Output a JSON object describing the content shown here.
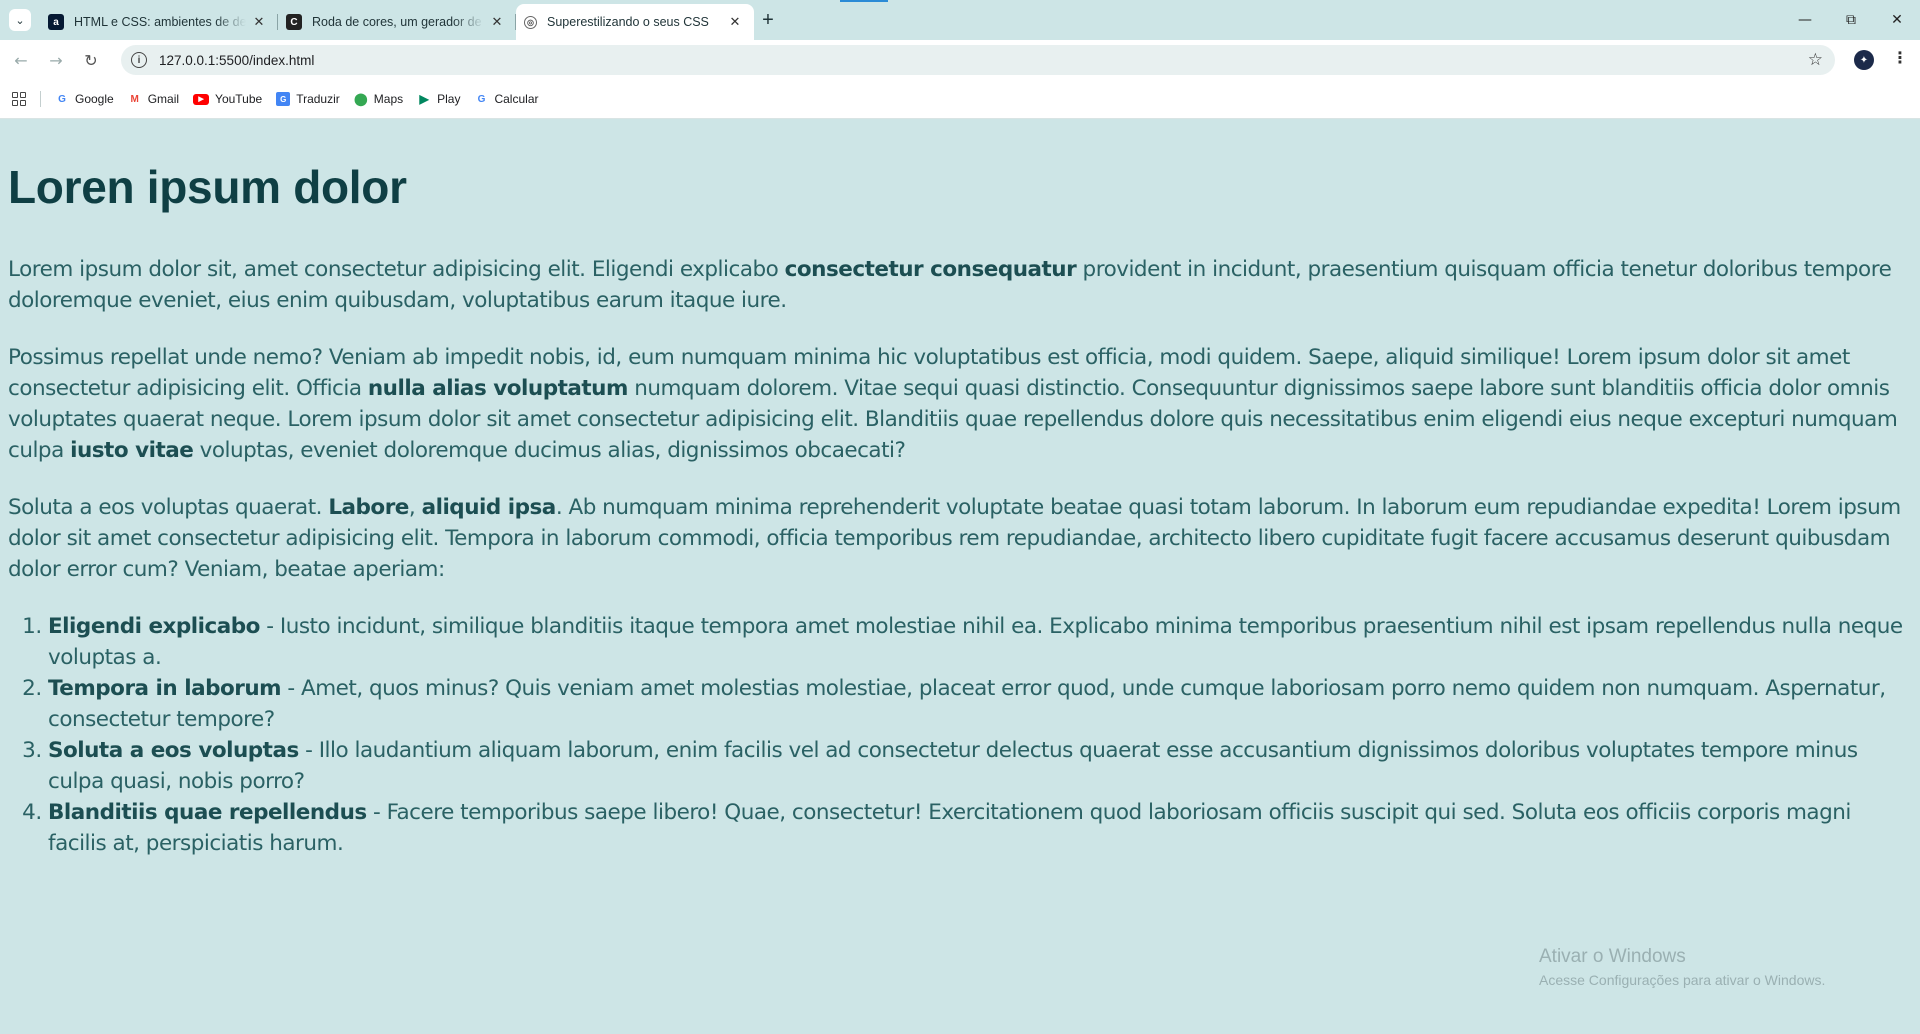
{
  "browser": {
    "tabs": [
      {
        "title": "HTML e CSS: ambientes de desenvolvimento",
        "favicon": "alura-icon",
        "active": false
      },
      {
        "title": "Roda de cores, um gerador de paletas",
        "favicon": "adobe-color-icon",
        "active": false
      },
      {
        "title": "Superestilizando o seus CSS",
        "favicon": "globe-icon",
        "active": true
      }
    ],
    "url": "127.0.0.1:5500/index.html",
    "bookmarks": [
      {
        "label": "Google",
        "icon": "google-icon"
      },
      {
        "label": "Gmail",
        "icon": "gmail-icon"
      },
      {
        "label": "YouTube",
        "icon": "youtube-icon"
      },
      {
        "label": "Traduzir",
        "icon": "translate-icon"
      },
      {
        "label": "Maps",
        "icon": "maps-icon"
      },
      {
        "label": "Play",
        "icon": "play-icon"
      },
      {
        "label": "Calcular",
        "icon": "google-icon"
      }
    ]
  },
  "page": {
    "title": "Loren ipsum dolor",
    "p1": {
      "a": "Lorem ipsum dolor sit, amet consectetur adipisicing elit. Eligendi explicabo ",
      "b1": "consectetur consequatur",
      "c": " provident in incidunt, praesentium quisquam officia tenetur doloribus tempore doloremque eveniet, eius enim quibusdam, voluptatibus earum itaque iure."
    },
    "p2": {
      "a": "Possimus repellat unde nemo? Veniam ab impedit nobis, id, eum numquam minima hic voluptatibus est officia, modi quidem. Saepe, aliquid similique! Lorem ipsum dolor sit amet consectetur adipisicing elit. Officia ",
      "b1": "nulla alias voluptatum",
      "c": " numquam dolorem. Vitae sequi quasi distinctio. Consequuntur dignissimos saepe labore sunt blanditiis officia dolor omnis voluptates quaerat neque. Lorem ipsum dolor sit amet consectetur adipisicing elit. Blanditiis quae repellendus dolore quis necessitatibus enim eligendi eius neque excepturi numquam culpa ",
      "b2": "iusto vitae",
      "d": " voluptas, eveniet doloremque ducimus alias, dignissimos obcaecati?"
    },
    "p3": {
      "a": "Soluta a eos voluptas quaerat. ",
      "b1": "Labore",
      "sep": ", ",
      "b2": "aliquid ipsa",
      "c": ". Ab numquam minima reprehenderit voluptate beatae quasi totam laborum. In laborum eum repudiandae expedita! Lorem ipsum dolor sit amet consectetur adipisicing elit. Tempora in laborum commodi, officia temporibus rem repudiandae, architecto libero cupiditate fugit facere accusamus deserunt quibusdam dolor error cum? Veniam, beatae aperiam:"
    },
    "list": [
      {
        "term": "Eligendi explicabo",
        "text": " - Iusto incidunt, similique blanditiis itaque tempora amet molestiae nihil ea. Explicabo minima temporibus praesentium nihil est ipsam repellendus nulla neque voluptas a."
      },
      {
        "term": "Tempora in laborum",
        "text": " - Amet, quos minus? Quis veniam amet molestias molestiae, placeat error quod, unde cumque laboriosam porro nemo quidem non numquam. Aspernatur, consectetur tempore?"
      },
      {
        "term": "Soluta a eos voluptas",
        "text": " - Illo laudantium aliquam laborum, enim facilis vel ad consectetur delectus quaerat esse accusantium dignissimos doloribus voluptates tempore minus culpa quasi, nobis porro?"
      },
      {
        "term": "Blanditiis quae repellendus",
        "text": " - Facere temporibus saepe libero! Quae, consectetur! Exercitationem quod laboriosam officiis suscipit qui sed. Soluta eos officiis corporis magni facilis at, perspiciatis harum."
      }
    ]
  },
  "watermark": {
    "line1": "Ativar o Windows",
    "line2": "Acesse Configurações para ativar o Windows."
  },
  "colors": {
    "page_background": "#cde5e6",
    "heading": "#0f3f44",
    "text": "#2a6164"
  }
}
